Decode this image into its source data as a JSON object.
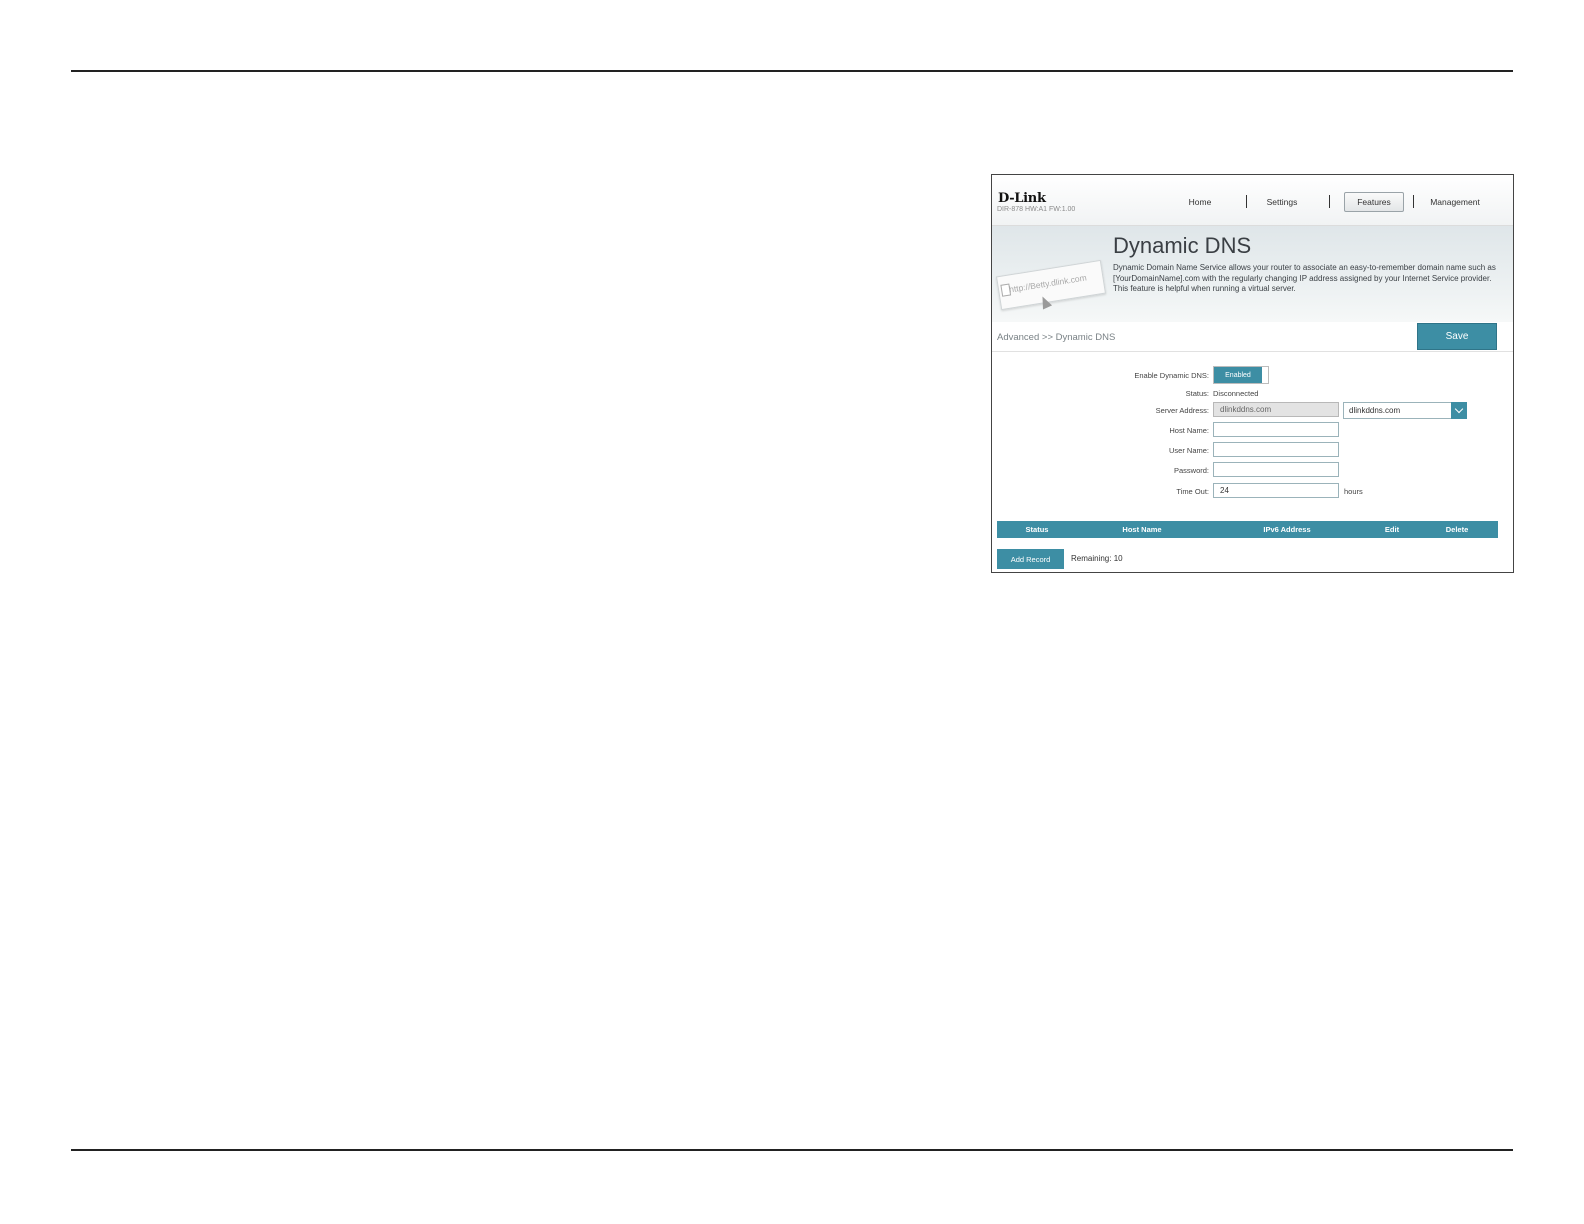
{
  "router_ui": {
    "header": {
      "logo": "D-Link",
      "model": "DIR-878 HW:A1 FW:1.00",
      "nav": {
        "home": "Home",
        "settings": "Settings",
        "features": "Features",
        "management": "Management"
      }
    },
    "banner": {
      "title": "Dynamic DNS",
      "description": "Dynamic Domain Name Service allows your router to associate an easy-to-remember domain name such as [YourDomainName].com with the regularly changing IP address assigned by your Internet Service provider. This feature is helpful when running a virtual server.",
      "illustration_text": "http://Betty.dlink.com"
    },
    "breadcrumb": "Advanced >> Dynamic DNS",
    "save_label": "Save",
    "form": {
      "enable_label": "Enable Dynamic DNS:",
      "enable_value": "Enabled",
      "status_label": "Status:",
      "status_value": "Disconnected",
      "server_label": "Server Address:",
      "server_value": "dlinkddns.com",
      "server_select_value": "dlinkddns.com",
      "host_label": "Host Name:",
      "host_value": "",
      "user_label": "User Name:",
      "user_value": "",
      "password_label": "Password:",
      "password_value": "",
      "timeout_label": "Time Out:",
      "timeout_value": "24",
      "timeout_unit": "hours"
    },
    "table": {
      "columns": [
        "Status",
        "Host Name",
        "IPv6 Address",
        "Edit",
        "Delete"
      ]
    },
    "add_record_label": "Add Record",
    "remaining_text": "Remaining: 10"
  },
  "colors": {
    "accent": "#3d8ea4"
  }
}
